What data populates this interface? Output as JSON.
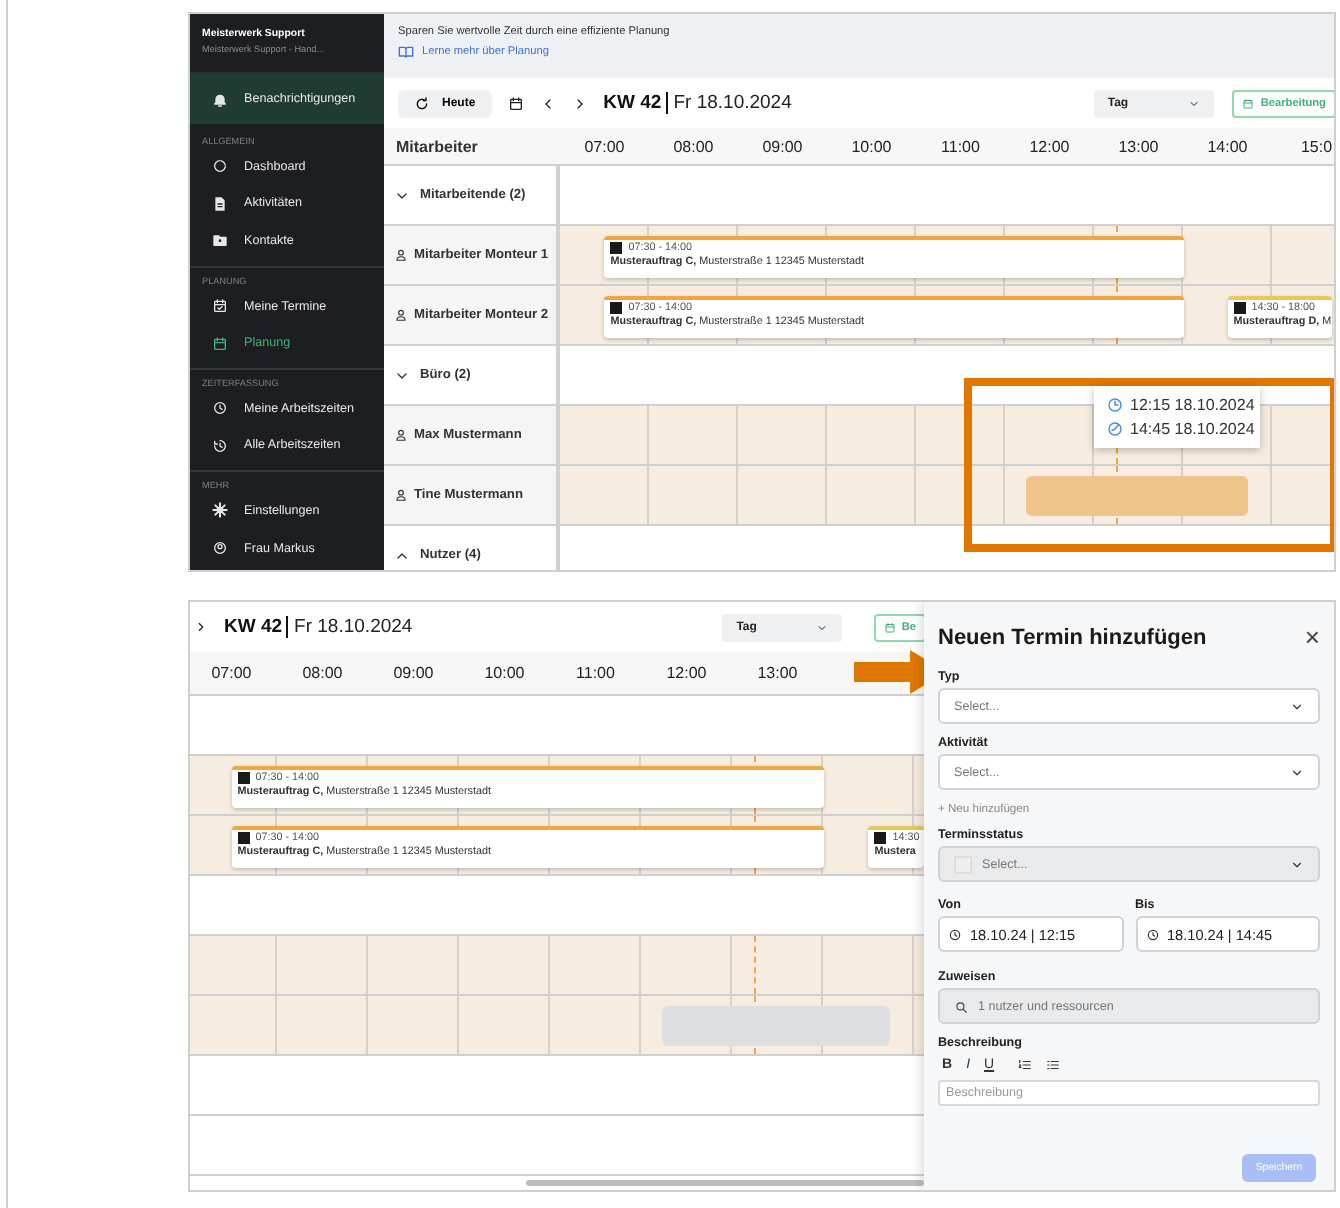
{
  "sidebar": {
    "org": "Meisterwerk Support",
    "org_sub": "Meisterwerk Support - Hand...",
    "items": [
      {
        "kind": "notice",
        "label": "Benachrichtigungen"
      },
      {
        "kind": "section",
        "label": "ALLGEMEIN"
      },
      {
        "kind": "item",
        "label": "Dashboard",
        "selected": false
      },
      {
        "kind": "item",
        "label": "Aktivitäten",
        "selected": false
      },
      {
        "kind": "item",
        "label": "Kontakte",
        "selected": false
      },
      {
        "kind": "section",
        "label": "PLANUNG"
      },
      {
        "kind": "item",
        "label": "Meine Termine",
        "selected": false
      },
      {
        "kind": "item",
        "label": "Planung",
        "selected": true
      },
      {
        "kind": "section",
        "label": "ZEITERFASSUNG"
      },
      {
        "kind": "item",
        "label": "Meine Arbeitszeiten",
        "selected": false
      },
      {
        "kind": "item",
        "label": "Alle Arbeitszeiten",
        "selected": false
      },
      {
        "kind": "section",
        "label": "MEHR"
      },
      {
        "kind": "item",
        "label": "Einstellungen",
        "selected": false
      },
      {
        "kind": "item",
        "label": "Frau Markus",
        "selected": false
      }
    ]
  },
  "banner": {
    "text": "Sparen Sie wertvolle Zeit durch eine effiziente Planung",
    "link": "Lerne mehr über Planung"
  },
  "top": {
    "toolbar": {
      "today": "Heute",
      "week": "KW 42",
      "date": "Fr 18.10.2024",
      "view": "Tag",
      "edit": "Bearbeitung"
    },
    "header_label": "Mitarbeiter",
    "hours": [
      "07:00",
      "08:00",
      "09:00",
      "10:00",
      "11:00",
      "12:00",
      "13:00",
      "14:00",
      "15:0"
    ],
    "rows": [
      {
        "kind": "group",
        "label": "Mitarbeitende (2)",
        "expanded": true
      },
      {
        "kind": "person",
        "label": "Mitarbeiter Monteur 1",
        "events": [
          {
            "time": "07:30 - 14:00",
            "label": "**Musterauftrag C,** Musterstraße 1 12345 Musterstadt",
            "color": "#f0a646"
          }
        ]
      },
      {
        "kind": "person",
        "label": "Mitarbeiter Monteur 2",
        "events": [
          {
            "time": "07:30 - 14:00",
            "label": "**Musterauftrag C,** Musterstraße 1 12345 Musterstadt",
            "color": "#f0a646"
          },
          {
            "time": "14:30 - 18:00",
            "label": "**Musterauftrag D,** M",
            "color": "#e8c85a"
          }
        ]
      },
      {
        "kind": "group",
        "label": "Büro (2)",
        "expanded": true
      },
      {
        "kind": "person",
        "label": "Max Mustermann"
      },
      {
        "kind": "person",
        "label": "Tine Mustermann",
        "selection": true
      },
      {
        "kind": "group",
        "label": "Nutzer (4)",
        "expanded": false
      }
    ],
    "tooltip": {
      "start": "12:15 18.10.2024",
      "end": "14:45 18.10.2024"
    }
  },
  "bottom": {
    "toolbar": {
      "week": "KW 42",
      "date": "Fr 18.10.2024",
      "view": "Tag",
      "edit": "Be"
    },
    "hours": [
      "07:00",
      "08:00",
      "09:00",
      "10:00",
      "11:00",
      "12:00",
      "13:00"
    ],
    "rows": [
      {
        "kind": "group"
      },
      {
        "kind": "person",
        "events": [
          {
            "time": "07:30 - 14:00",
            "label": "**Musterauftrag C,** Musterstraße 1 12345 Musterstadt",
            "color": "#f0a646"
          }
        ]
      },
      {
        "kind": "person",
        "events": [
          {
            "time": "07:30 - 14:00",
            "label": "**Musterauftrag C,** Musterstraße 1 12345 Musterstadt",
            "color": "#f0a646"
          },
          {
            "time": "14:30",
            "label": "**Mustera**",
            "color": "#e8c85a"
          }
        ]
      },
      {
        "kind": "group"
      },
      {
        "kind": "person"
      },
      {
        "kind": "person",
        "selection": true
      },
      {
        "kind": "group"
      },
      {
        "kind": "group"
      }
    ]
  },
  "drawer": {
    "title": "Neuen Termin hinzufügen",
    "close": "×",
    "fields": [
      {
        "kind": "select",
        "label": "Typ",
        "placeholder": "Select...",
        "disabled": false
      },
      {
        "kind": "select",
        "label": "Aktivität",
        "placeholder": "Select...",
        "disabled": false,
        "link": "+ Neu hinzufügen"
      },
      {
        "kind": "status",
        "label": "Terminsstatus",
        "placeholder": "Select...",
        "disabled": true
      },
      {
        "kind": "range",
        "from": {
          "label": "Von",
          "value": "18.10.24 | 12:15"
        },
        "to": {
          "label": "Bis",
          "value": "18.10.24 | 14:45"
        }
      },
      {
        "kind": "search",
        "label": "Zuweisen",
        "placeholder": "1 nutzer und ressourcen"
      },
      {
        "kind": "editor",
        "label": "Beschreibung",
        "tools": [
          "B",
          "I",
          "U"
        ],
        "placeholder": "Beschreibung"
      }
    ],
    "save": {
      "label": "Speichern",
      "disabled": true
    }
  }
}
